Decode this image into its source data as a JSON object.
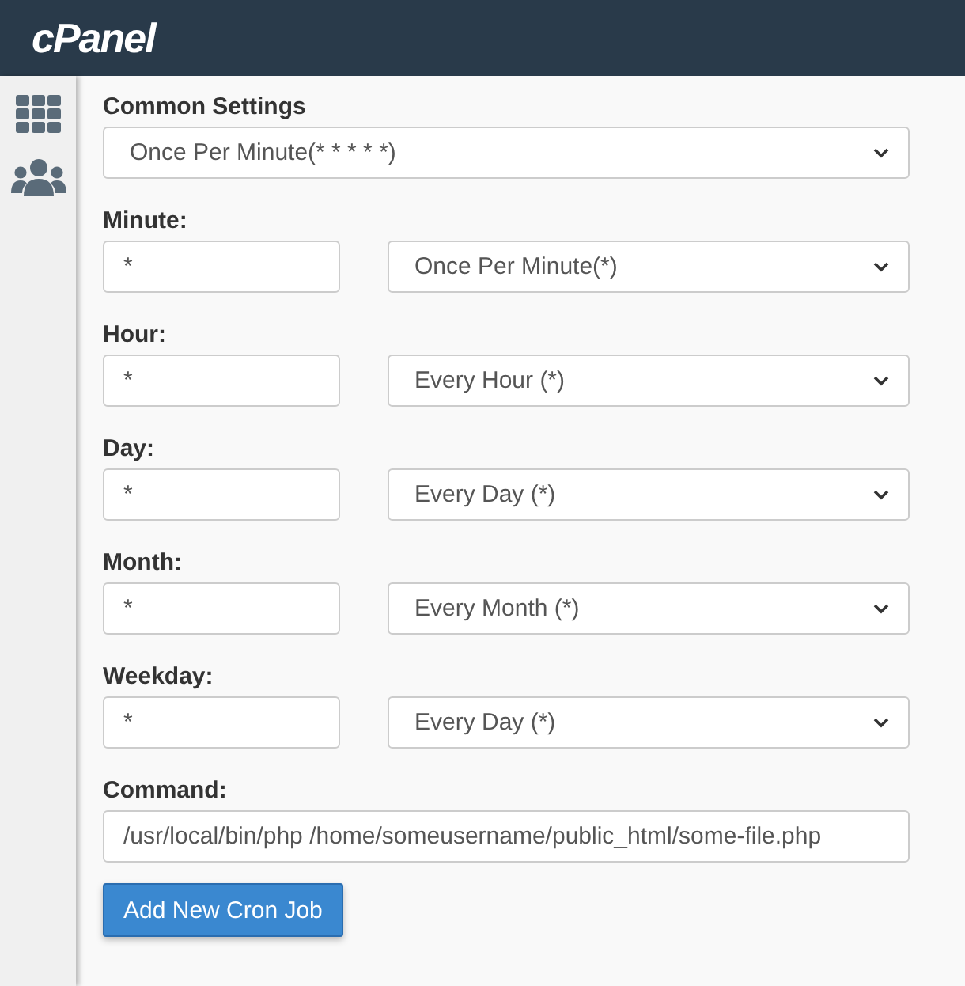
{
  "header": {
    "logo": "cPanel"
  },
  "common_settings": {
    "label": "Common Settings",
    "value": "Once Per Minute(* * * * *)"
  },
  "fields": [
    {
      "label": "Minute:",
      "value": "*",
      "preset": "Once Per Minute(*)"
    },
    {
      "label": "Hour:",
      "value": "*",
      "preset": "Every Hour (*)"
    },
    {
      "label": "Day:",
      "value": "*",
      "preset": "Every Day (*)"
    },
    {
      "label": "Month:",
      "value": "*",
      "preset": "Every Month (*)"
    },
    {
      "label": "Weekday:",
      "value": "*",
      "preset": "Every Day (*)"
    }
  ],
  "command": {
    "label": "Command:",
    "value": "/usr/local/bin/php /home/someusername/public_html/some-file.php"
  },
  "submit_button": "Add New Cron Job"
}
